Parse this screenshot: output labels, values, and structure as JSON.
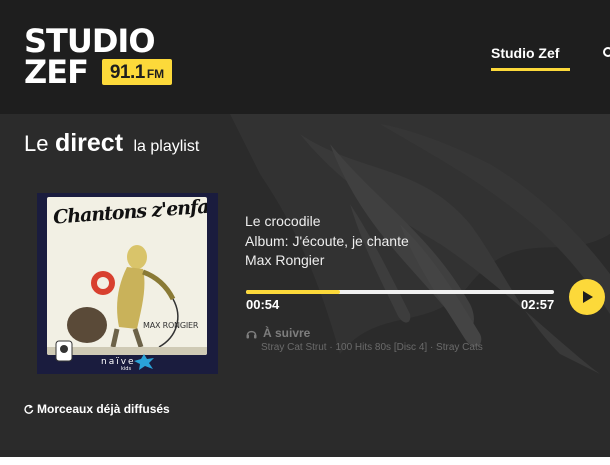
{
  "header": {
    "logo": {
      "line1": "STUDIO",
      "line2": "ZEF",
      "freq": "91.1",
      "unit": "FM"
    },
    "nav": {
      "active_item": "Studio Zef"
    }
  },
  "section": {
    "le": "Le",
    "direct": "direct",
    "playlist": "la playlist"
  },
  "now_playing": {
    "cover": {
      "title": "Chantons z'enfants",
      "artist": "MAX RONGIER",
      "label": "naïve",
      "label_sub": "kids"
    },
    "title": "Le crocodile",
    "album": "Album: J'écoute, je chante",
    "artist": "Max Rongier",
    "current_time": "00:54",
    "total_time": "02:57",
    "progress_fraction": 0.305
  },
  "next": {
    "label": "À suivre",
    "track": "Stray Cat Strut · 100 Hits 80s [Disc 4] · Stray Cats"
  },
  "history": {
    "label": "Morceaux déjà diffusés"
  },
  "colors": {
    "accent": "#fcd93a",
    "header_bg": "#1e1e1e",
    "main_bg": "#2b2b2b"
  }
}
